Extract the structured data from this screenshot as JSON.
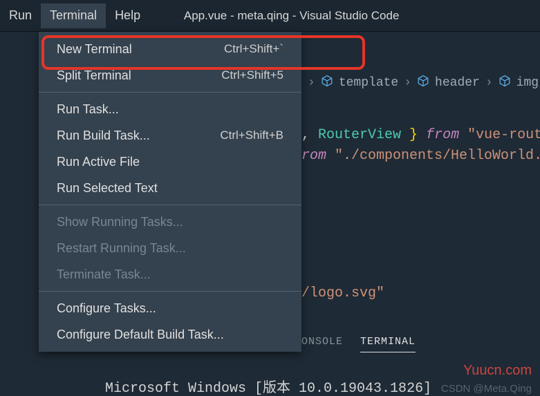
{
  "menubar": {
    "items": [
      "Run",
      "Terminal",
      "Help"
    ],
    "active_index": 1
  },
  "window_title": "App.vue - meta.qing - Visual Studio Code",
  "dropdown": {
    "groups": [
      [
        {
          "label": "New Terminal",
          "shortcut": "Ctrl+Shift+`",
          "enabled": true
        },
        {
          "label": "Split Terminal",
          "shortcut": "Ctrl+Shift+5",
          "enabled": true
        }
      ],
      [
        {
          "label": "Run Task...",
          "shortcut": "",
          "enabled": true
        },
        {
          "label": "Run Build Task...",
          "shortcut": "Ctrl+Shift+B",
          "enabled": true
        },
        {
          "label": "Run Active File",
          "shortcut": "",
          "enabled": true
        },
        {
          "label": "Run Selected Text",
          "shortcut": "",
          "enabled": true
        }
      ],
      [
        {
          "label": "Show Running Tasks...",
          "shortcut": "",
          "enabled": false
        },
        {
          "label": "Restart Running Task...",
          "shortcut": "",
          "enabled": false
        },
        {
          "label": "Terminate Task...",
          "shortcut": "",
          "enabled": false
        }
      ],
      [
        {
          "label": "Configure Tasks...",
          "shortcut": "",
          "enabled": true
        },
        {
          "label": "Configure Default Build Task...",
          "shortcut": "",
          "enabled": true
        }
      ]
    ]
  },
  "breadcrumb": {
    "items": [
      "template",
      "header",
      "img.l"
    ],
    "chevron": "›",
    "leading_chevron": "›"
  },
  "code": {
    "line1_pre": ", ",
    "line1_type": "RouterView",
    "line1_brace": " } ",
    "line1_from": "from ",
    "line1_str": "\"vue-rout",
    "line2_from": "rom ",
    "line2_str": "\"./components/HelloWorld.",
    "line3_str": "/logo.svg\""
  },
  "panel": {
    "tabs": [
      "ONSOLE",
      "TERMINAL"
    ],
    "active_index": 1
  },
  "terminal_output": "Microsoft Windows [版本 10.0.19043.1826]",
  "watermarks": {
    "w1": "Yuucn.com",
    "w2": "CSDN @Meta.Qing"
  }
}
